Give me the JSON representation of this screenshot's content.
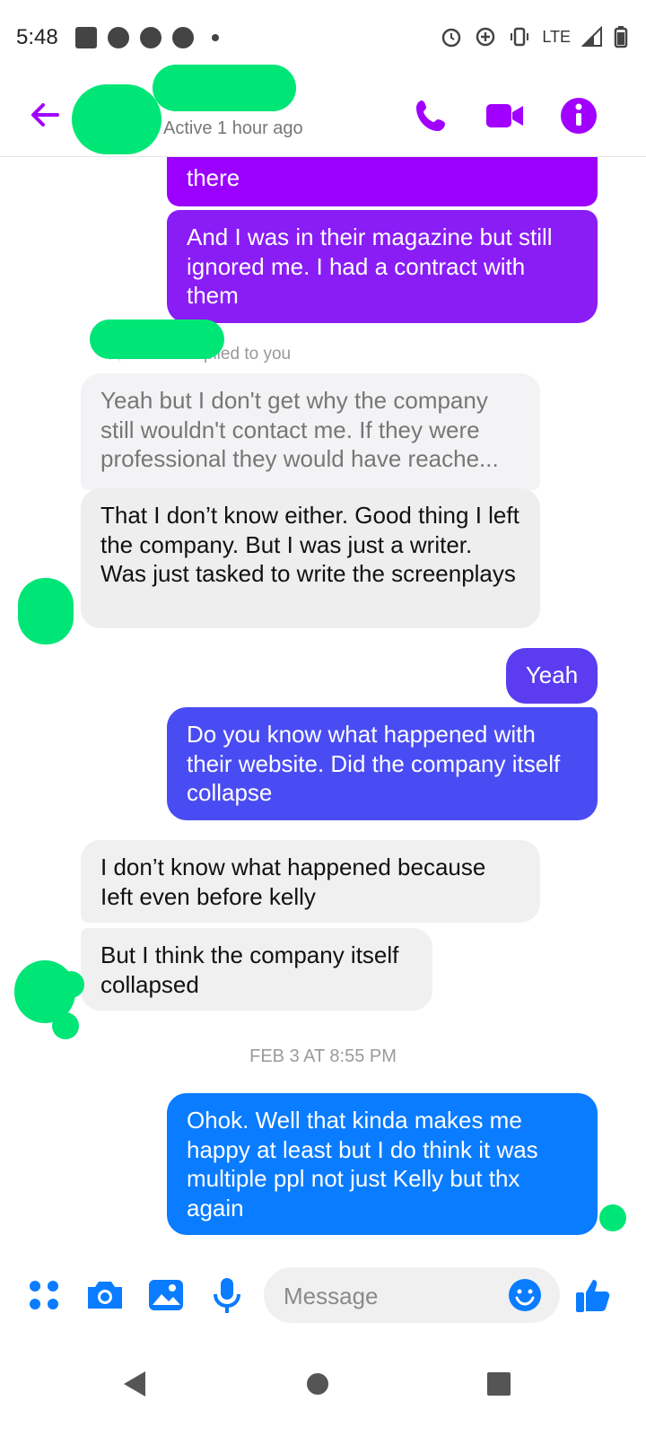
{
  "status_bar": {
    "time": "5:48",
    "network": "LTE"
  },
  "header": {
    "status": "Active 1 hour ago"
  },
  "messages": {
    "m1": "there",
    "m2": "And I was in their magazine but still ignored me. I had a contract with them",
    "reply_note": "replied to you",
    "m3_quoted": "Yeah but I don't get why the company still wouldn't contact me. If they were professional they would have reache...",
    "m4": "That I don’t know either. Good thing I left the company. But I was just a writer. Was just tasked to write the screenplays",
    "m5": "Yeah",
    "m6": "Do you know what happened with their website. Did the company itself collapse",
    "m7": "I don’t know what happened because Ieft even before kelly",
    "m8": "But I think the company itself collapsed",
    "date": "FEB 3 AT 8:55 PM",
    "m9": "Ohok. Well that kinda makes me happy at least but I do think it was multiple ppl not just Kelly but thx again"
  },
  "composer": {
    "placeholder": "Message"
  },
  "colors": {
    "accent_purple": "#a100ff",
    "bubble_purple": "#9b00ff",
    "bubble_violet": "#8a1cf5",
    "bubble_indigo": "#4a4cf3",
    "bubble_blue": "#0a7cff",
    "composer_blue": "#0a7cff",
    "redaction": "#00e676"
  },
  "icons": [
    "back-arrow-icon",
    "phone-icon",
    "video-icon",
    "info-icon",
    "apps-icon",
    "camera-icon",
    "gallery-icon",
    "mic-icon",
    "emoji-icon",
    "thumbs-up-icon",
    "nav-back-icon",
    "nav-home-icon",
    "nav-recents-icon"
  ]
}
